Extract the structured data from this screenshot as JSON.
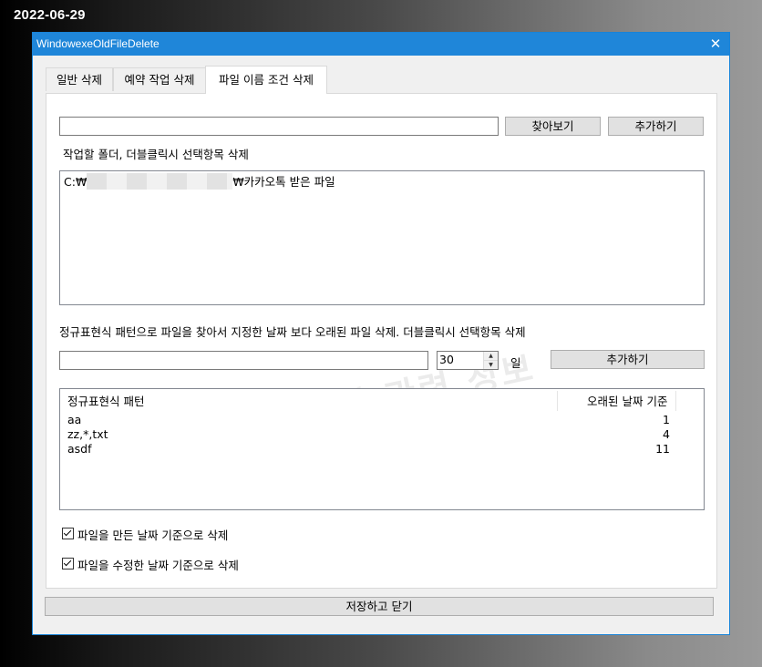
{
  "date_stamp": "2022-06-29",
  "window": {
    "title": "WindowexeOldFileDelete",
    "close_glyph": "✕"
  },
  "tabs": [
    {
      "label": "일반 삭제",
      "active": false
    },
    {
      "label": "예약 작업 삭제",
      "active": false
    },
    {
      "label": "파일 이름 조건 삭제",
      "active": true
    }
  ],
  "folder_section": {
    "path_input_value": "",
    "browse_button": "찾아보기",
    "add_button": "추가하기",
    "instruction": "작업할 폴더, 더블클릭시 선택항목 삭제",
    "folders": [
      {
        "prefix": "C:₩",
        "suffix": "₩카카오톡 받은 파일"
      }
    ]
  },
  "pattern_section": {
    "instruction": "정규표현식 패턴으로 파일을 찾아서 지정한 날짜 보다 오래된 파일 삭제. 더블클릭시 선택항목 삭제",
    "pattern_input_value": "",
    "days_value": "30",
    "days_unit": "일",
    "add_button": "추가하기",
    "columns": [
      "정규표현식 패턴",
      "오래된 날짜 기준"
    ],
    "rows": [
      {
        "pattern": "aa",
        "days": "1"
      },
      {
        "pattern": "zz,*,txt",
        "days": "4"
      },
      {
        "pattern": "asdf",
        "days": "11"
      }
    ]
  },
  "options": [
    {
      "label": "파일을 만든 날짜 기준으로 삭제",
      "checked": true
    },
    {
      "label": "파일을 수정한 날짜 기준으로 삭제",
      "checked": true
    }
  ],
  "save_close_button": "저장하고 닫기",
  "watermark": "컴퓨터 관련 정보"
}
